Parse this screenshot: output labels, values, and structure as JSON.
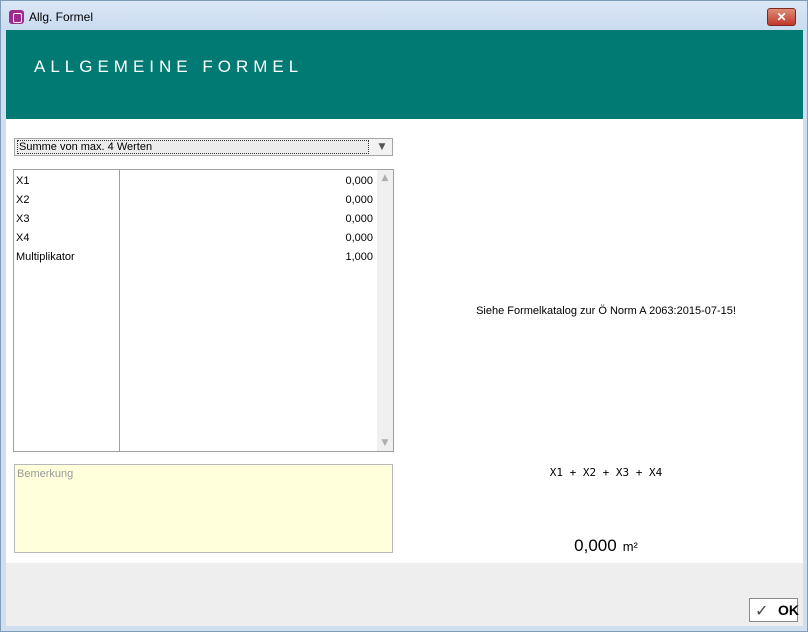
{
  "window": {
    "title": "Allg. Formel",
    "close_label": "✕"
  },
  "header": {
    "title": "ALLGEMEINE FORMEL"
  },
  "formula_select": {
    "selected": "Summe von max. 4 Werten"
  },
  "parameters": [
    {
      "label": "X1",
      "value": "0,000"
    },
    {
      "label": "X2",
      "value": "0,000"
    },
    {
      "label": "X3",
      "value": "0,000"
    },
    {
      "label": "X4",
      "value": "0,000"
    },
    {
      "label": "Multiplikator",
      "value": "1,000"
    }
  ],
  "remark": {
    "placeholder": "Bemerkung"
  },
  "info": {
    "note": "Siehe Formelkatalog zur Ö Norm A 2063:2015-07-15!",
    "formula": "X1 + X2 + X3 + X4",
    "result_value": "0,000",
    "result_unit": "m²"
  },
  "footer": {
    "ok_label": "OK"
  },
  "colors": {
    "header_band": "#017a74",
    "remark_background": "#ffffdc"
  },
  "icons": {
    "app": "app-icon",
    "close": "close-icon",
    "dropdown": "chevron-down-icon",
    "ok": "check-icon"
  }
}
